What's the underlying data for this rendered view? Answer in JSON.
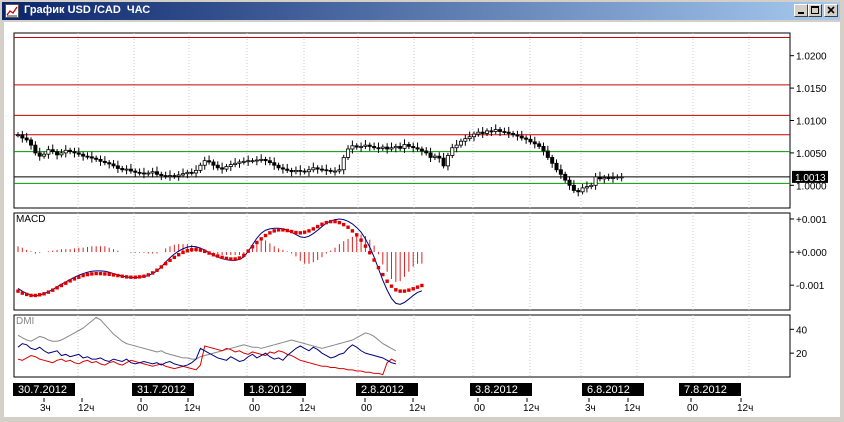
{
  "window": {
    "title": "График USD /CAD  ЧАС",
    "icons": [
      "chart-icon",
      "minimize-icon",
      "maximize-icon",
      "close-icon"
    ]
  },
  "colors": {
    "candle": "#000000",
    "resistance": "#cc0000",
    "support": "#009900",
    "macd_line": "#000080",
    "signal": "#dd0000",
    "dmi_plus": "#000080",
    "dmi_minus": "#dd0000",
    "adx": "#888888"
  },
  "chart_data": [
    {
      "type": "candlestick",
      "title": "",
      "y_ticks": [
        1.0,
        1.005,
        1.01,
        1.015,
        1.02
      ],
      "y_tick_labels": [
        "1.0000",
        "1.0050",
        "1.0100",
        "1.0150",
        "1.0200"
      ],
      "ylim": [
        0.9965,
        1.0235
      ],
      "current_price": 1.0013,
      "current_price_label": "1.0013",
      "h_lines": [
        {
          "value": 1.0228,
          "color": "red"
        },
        {
          "value": 1.0155,
          "color": "red"
        },
        {
          "value": 1.0108,
          "color": "red"
        },
        {
          "value": 1.0078,
          "color": "red"
        },
        {
          "value": 1.0052,
          "color": "green"
        },
        {
          "value": 1.0013,
          "color": "black"
        },
        {
          "value": 1.0003,
          "color": "green"
        }
      ],
      "closes": [
        1.0078,
        1.0073,
        1.007,
        1.0062,
        1.005,
        1.0045,
        1.0048,
        1.0055,
        1.0052,
        1.0047,
        1.005,
        1.0054,
        1.0052,
        1.005,
        1.0048,
        1.0045,
        1.0044,
        1.0042,
        1.004,
        1.0037,
        1.0035,
        1.0033,
        1.003,
        1.0026,
        1.0024,
        1.0025,
        1.0022,
        1.002,
        1.0019,
        1.0018,
        1.0019,
        1.0021,
        1.0017,
        1.0015,
        1.0014,
        1.0015,
        1.0014,
        1.0016,
        1.0018,
        1.002,
        1.0019,
        1.0023,
        1.0031,
        1.0038,
        1.0036,
        1.0031,
        1.0027,
        1.0025,
        1.0029,
        1.0032,
        1.0034,
        1.0036,
        1.0037,
        1.0038,
        1.0038,
        1.0039,
        1.004,
        1.0038,
        1.0035,
        1.0031,
        1.0027,
        1.0025,
        1.0023,
        1.0021,
        1.0023,
        1.0022,
        1.0021,
        1.0024,
        1.0027,
        1.0025,
        1.0024,
        1.0023,
        1.0022,
        1.0022,
        1.0024,
        1.0043,
        1.0056,
        1.0061,
        1.0059,
        1.006,
        1.0062,
        1.006,
        1.0058,
        1.0057,
        1.0059,
        1.0056,
        1.0058,
        1.006,
        1.0057,
        1.0063,
        1.006,
        1.0058,
        1.0056,
        1.0053,
        1.005,
        1.0043,
        1.0045,
        1.0042,
        1.003,
        1.0046,
        1.0058,
        1.0062,
        1.0068,
        1.0072,
        1.0075,
        1.0079,
        1.0082,
        1.008,
        1.0084,
        1.0083,
        1.0086,
        1.0083,
        1.0082,
        1.008,
        1.0078,
        1.0076,
        1.0073,
        1.0071,
        1.0067,
        1.0064,
        1.006,
        1.0053,
        1.0043,
        1.0034,
        1.0024,
        1.0017,
        1.0008,
        1.0,
        0.9992,
        0.999,
        0.9996,
        0.9998,
        1.0,
        1.0013,
        1.001,
        1.0012,
        1.0011,
        1.0012,
        1.0013,
        1.0013
      ]
    },
    {
      "type": "macd",
      "label": "MACD",
      "y_ticks": [
        0.001,
        0.0,
        -0.001
      ],
      "y_tick_labels": [
        "+0.001",
        "+0.000",
        "-0.001"
      ],
      "ylim": [
        -0.00175,
        0.00118
      ],
      "macd": [
        -0.0011,
        -0.00118,
        -0.00125,
        -0.0013,
        -0.00133,
        -0.0013,
        -0.00126,
        -0.0012,
        -0.00113,
        -0.00105,
        -0.00097,
        -0.0009,
        -0.00083,
        -0.00076,
        -0.0007,
        -0.00065,
        -0.00061,
        -0.00058,
        -0.00057,
        -0.00057,
        -0.00058,
        -0.00061,
        -0.00065,
        -0.00069,
        -0.00073,
        -0.00075,
        -0.00077,
        -0.00077,
        -0.00076,
        -0.00074,
        -0.00071,
        -0.00065,
        -0.00057,
        -0.00045,
        -0.0003,
        -0.00017,
        -6e-05,
        3e-05,
        0.0001,
        0.00015,
        0.00017,
        0.00016,
        0.00012,
        6e-05,
        -2e-05,
        -9e-05,
        -0.00015,
        -0.0002,
        -0.00023,
        -0.00025,
        -0.00025,
        -0.00022,
        -0.00015,
        2e-05,
        0.00022,
        0.00042,
        0.00057,
        0.00066,
        0.0007,
        0.00072,
        0.00072,
        0.0007,
        0.00066,
        0.0006,
        0.00053,
        0.00046,
        0.00044,
        0.00048,
        0.00056,
        0.00066,
        0.00077,
        0.00087,
        0.00094,
        0.00098,
        0.001,
        0.00098,
        0.00093,
        0.00085,
        0.00074,
        0.0006,
        0.0004,
        0.00015,
        -0.00015,
        -0.0005,
        -0.00085,
        -0.00115,
        -0.0014,
        -0.00155,
        -0.00158,
        -0.00152,
        -0.00142,
        -0.00131,
        -0.00122,
        -0.00117
      ],
      "signal": [
        -0.00118,
        -0.00124,
        -0.00128,
        -0.00131,
        -0.00131,
        -0.00129,
        -0.00126,
        -0.00121,
        -0.00115,
        -0.00108,
        -0.00101,
        -0.00094,
        -0.00087,
        -0.00081,
        -0.00076,
        -0.00071,
        -0.00068,
        -0.00066,
        -0.00065,
        -0.00065,
        -0.00066,
        -0.00067,
        -0.00069,
        -0.00071,
        -0.00073,
        -0.00075,
        -0.00076,
        -0.00076,
        -0.00075,
        -0.00073,
        -0.00069,
        -0.00063,
        -0.00055,
        -0.00045,
        -0.00035,
        -0.00025,
        -0.00016,
        -8e-05,
        -1e-05,
        4e-05,
        7e-05,
        8e-05,
        6e-05,
        2e-05,
        -3e-05,
        -8e-05,
        -0.00012,
        -0.00016,
        -0.00019,
        -0.00021,
        -0.00021,
        -0.00018,
        -0.0001,
        3e-05,
        0.00016,
        0.00029,
        0.0004,
        0.0005,
        0.00058,
        0.00064,
        0.00067,
        0.00067,
        0.00065,
        0.00062,
        0.00059,
        0.00058,
        0.0006,
        0.00064,
        0.0007,
        0.00077,
        0.00084,
        0.00089,
        0.00092,
        0.00092,
        0.00089,
        0.00083,
        0.00075,
        0.00064,
        0.00052,
        0.00036,
        0.00018,
        -2e-05,
        -0.00024,
        -0.00047,
        -0.00068,
        -0.00088,
        -0.00103,
        -0.00114,
        -0.00118,
        -0.00118,
        -0.00115,
        -0.00111,
        -0.00106,
        -0.00101
      ]
    },
    {
      "type": "dmi",
      "label": "DMI",
      "y_ticks": [
        40,
        20
      ],
      "y_tick_labels": [
        "40",
        "20"
      ],
      "ylim": [
        0,
        52
      ],
      "plus_di": [
        25,
        28,
        27,
        24,
        23,
        25,
        22,
        20,
        21,
        22,
        18,
        19,
        17,
        18,
        19,
        16,
        17,
        15,
        15,
        16,
        14,
        13,
        15,
        14,
        13,
        15,
        12,
        11,
        12,
        13,
        12,
        11,
        12,
        10,
        12,
        13,
        11,
        10,
        9,
        10,
        12,
        15,
        24,
        22,
        20,
        18,
        16,
        15,
        14,
        17,
        15,
        13,
        14,
        17,
        19,
        16,
        18,
        20,
        17,
        15,
        16,
        14,
        18,
        21,
        24,
        26,
        24,
        22,
        25,
        23,
        20,
        18,
        16,
        17,
        19,
        20,
        24,
        27,
        25,
        22,
        20,
        19,
        18,
        17,
        16,
        14,
        12,
        11
      ],
      "minus_di": [
        15,
        14,
        16,
        18,
        17,
        15,
        14,
        13,
        12,
        14,
        15,
        13,
        14,
        12,
        11,
        13,
        14,
        12,
        13,
        11,
        10,
        12,
        13,
        11,
        10,
        12,
        14,
        13,
        12,
        11,
        10,
        9,
        10,
        11,
        9,
        8,
        7,
        8,
        9,
        8,
        7,
        6,
        10,
        26,
        25,
        24,
        23,
        22,
        24,
        23,
        21,
        22,
        20,
        19,
        21,
        20,
        19,
        18,
        21,
        20,
        22,
        21,
        19,
        18,
        16,
        14,
        13,
        12,
        11,
        10,
        9,
        9,
        8,
        8,
        7,
        7,
        6,
        6,
        5,
        5,
        4,
        4,
        3,
        3,
        2,
        12,
        15,
        13
      ],
      "adx": [
        35,
        33,
        31,
        30,
        32,
        34,
        33,
        31,
        30,
        30,
        31,
        33,
        35,
        37,
        39,
        41,
        44,
        47,
        50,
        48,
        44,
        40,
        36,
        33,
        30,
        28,
        27,
        26,
        25,
        24,
        23,
        22,
        21,
        22,
        20,
        19,
        18,
        17,
        16,
        16,
        15,
        15,
        17,
        18,
        19,
        20,
        21,
        22,
        23,
        24,
        25,
        26,
        27,
        26,
        25,
        25,
        24,
        25,
        26,
        27,
        28,
        29,
        30,
        31,
        30,
        29,
        28,
        27,
        26,
        25,
        24,
        25,
        26,
        27,
        28,
        29,
        30,
        31,
        33,
        35,
        37,
        36,
        34,
        31,
        28,
        26,
        24,
        22
      ]
    }
  ],
  "x_axis": {
    "date_labels": [
      "30.7.2012",
      "31.7.2012",
      "1.8.2012",
      "2.8.2012",
      "3.8.2012",
      "6.8.2012",
      "7.8.2012"
    ],
    "hour_labels": [
      "3ч",
      "12ч",
      "00",
      "12ч",
      "00",
      "12ч",
      "00",
      "12ч",
      "00",
      "12ч",
      "3ч",
      "12ч",
      "00",
      "12ч"
    ]
  }
}
